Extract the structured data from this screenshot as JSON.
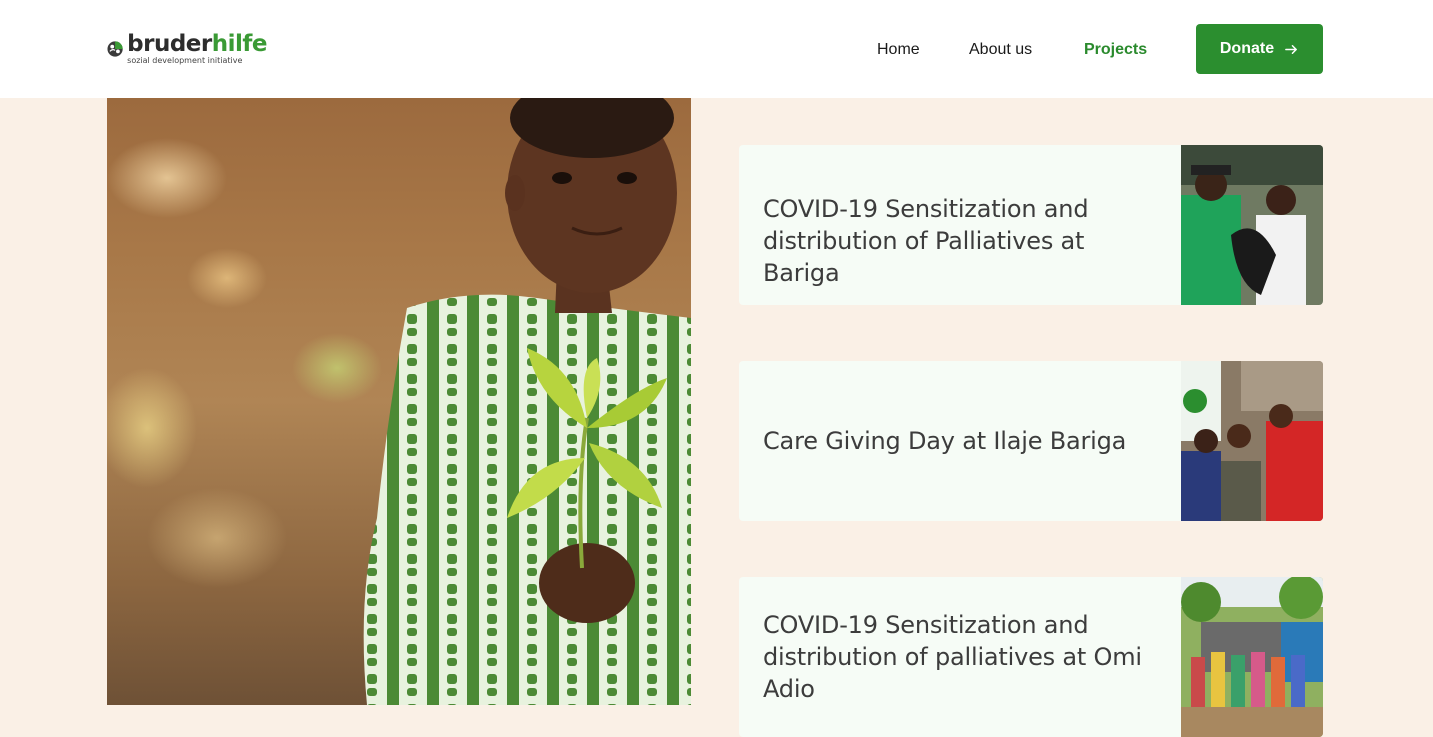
{
  "brand": {
    "name_dark": "bruder",
    "name_green": "hilfe",
    "tagline": "sozial development initiative",
    "accent": "#2b8e2f"
  },
  "nav": {
    "items": [
      {
        "label": "Home",
        "active": false
      },
      {
        "label": "About us",
        "active": false
      },
      {
        "label": "Projects",
        "active": true
      }
    ],
    "donate_label": "Donate",
    "donate_icon": "arrow-right-icon"
  },
  "hero": {
    "image": "child-holding-seedling-photo"
  },
  "projects": [
    {
      "title": "COVID-19 Sensitization and distribution of Palliatives at Bariga",
      "image": "volunteers-distributing-palliatives-photo"
    },
    {
      "title": "Care Giving Day at Ilaje Bariga",
      "image": "community-care-giving-photo"
    },
    {
      "title": "COVID-19 Sensitization and distribution of palliatives at Omi Adio",
      "image": "community-gathering-photo"
    }
  ]
}
